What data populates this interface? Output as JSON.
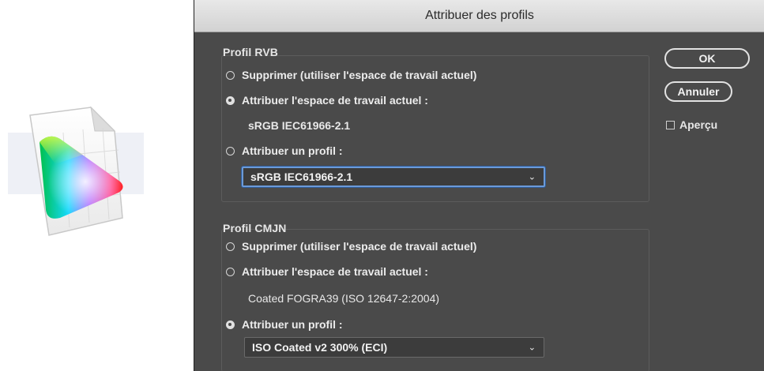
{
  "icon": {
    "name": "color-profile-document-icon"
  },
  "dialog": {
    "title": "Attribuer des profils",
    "rvb": {
      "title": "Profil RVB",
      "option_delete": "Supprimer (utiliser l'espace de travail actuel)",
      "option_assign_current": "Attribuer l'espace de travail actuel :",
      "current_space": "sRGB IEC61966-2.1",
      "option_assign_profile": "Attribuer un profil :",
      "selected_profile": "sRGB IEC61966-2.1",
      "checked_option": "assign_current"
    },
    "cmjn": {
      "title": "Profil CMJN",
      "option_delete": "Supprimer (utiliser l'espace de travail actuel)",
      "option_assign_current": "Attribuer l'espace de travail actuel :",
      "current_space": "Coated FOGRA39 (ISO 12647-2:2004)",
      "option_assign_profile": "Attribuer un profil :",
      "selected_profile": "ISO Coated v2 300% (ECI)",
      "checked_option": "assign_profile"
    },
    "buttons": {
      "ok": "OK",
      "cancel": "Annuler"
    },
    "preview": {
      "label": "Aperçu",
      "checked": false
    }
  }
}
